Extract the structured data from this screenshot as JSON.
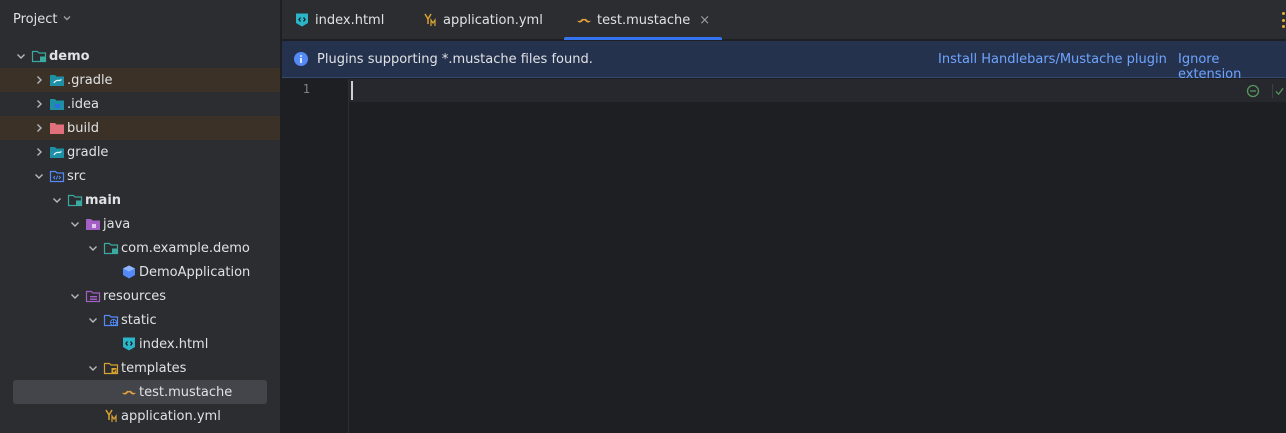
{
  "project_panel": {
    "title": "Project",
    "tree": [
      {
        "label": "demo",
        "level": 0,
        "expanded": true,
        "icon": "module-folder-icon",
        "bold": true,
        "excluded": false
      },
      {
        "label": ".gradle",
        "level": 1,
        "expanded": false,
        "icon": "gradle-folder-icon",
        "bold": false,
        "excluded": true
      },
      {
        "label": ".idea",
        "level": 1,
        "expanded": false,
        "icon": "idea-folder-icon",
        "bold": false,
        "excluded": false
      },
      {
        "label": "build",
        "level": 1,
        "expanded": false,
        "icon": "excluded-folder-icon",
        "bold": false,
        "excluded": true
      },
      {
        "label": "gradle",
        "level": 1,
        "expanded": false,
        "icon": "gradle-folder-icon",
        "bold": false,
        "excluded": false
      },
      {
        "label": "src",
        "level": 1,
        "expanded": true,
        "icon": "source-folder-icon",
        "bold": false,
        "excluded": false
      },
      {
        "label": "main",
        "level": 2,
        "expanded": true,
        "icon": "module-folder-icon",
        "bold": true,
        "excluded": false
      },
      {
        "label": "java",
        "level": 3,
        "expanded": true,
        "icon": "java-source-root-icon",
        "bold": false,
        "excluded": false
      },
      {
        "label": "com.example.demo",
        "level": 4,
        "expanded": true,
        "icon": "package-icon",
        "bold": false,
        "excluded": false
      },
      {
        "label": "DemoApplication",
        "level": 5,
        "expanded": null,
        "icon": "spring-class-icon",
        "bold": false,
        "excluded": false
      },
      {
        "label": "resources",
        "level": 3,
        "expanded": true,
        "icon": "resources-root-icon",
        "bold": false,
        "excluded": false
      },
      {
        "label": "static",
        "level": 4,
        "expanded": true,
        "icon": "web-folder-icon",
        "bold": false,
        "excluded": false
      },
      {
        "label": "index.html",
        "level": 5,
        "expanded": null,
        "icon": "html-file-icon",
        "bold": false,
        "excluded": false
      },
      {
        "label": "templates",
        "level": 4,
        "expanded": true,
        "icon": "templates-folder-icon",
        "bold": false,
        "excluded": false
      },
      {
        "label": "test.mustache",
        "level": 5,
        "expanded": null,
        "icon": "mustache-file-icon",
        "bold": false,
        "excluded": false,
        "selected": true
      },
      {
        "label": "application.yml",
        "level": 4,
        "expanded": null,
        "icon": "yaml-file-icon",
        "bold": false,
        "excluded": false
      }
    ]
  },
  "tabs": [
    {
      "label": "index.html",
      "icon": "html-file-icon",
      "active": false
    },
    {
      "label": "application.yml",
      "icon": "yaml-file-icon",
      "active": false
    },
    {
      "label": "test.mustache",
      "icon": "mustache-file-icon",
      "active": true,
      "close": "×"
    }
  ],
  "notification": {
    "message": "Plugins supporting *.mustache files found.",
    "install_link": "Install Handlebars/Mustache plugin",
    "ignore_link": "Ignore extension",
    "icon": "info-icon"
  },
  "editor": {
    "line_numbers": [
      "1"
    ],
    "content": ""
  },
  "colors": {
    "accent": "#3574f0",
    "link": "#6ea4ff",
    "excluded_row": "#3b3126",
    "selected_row": "#43454a",
    "mustache": "#e8a33d"
  }
}
